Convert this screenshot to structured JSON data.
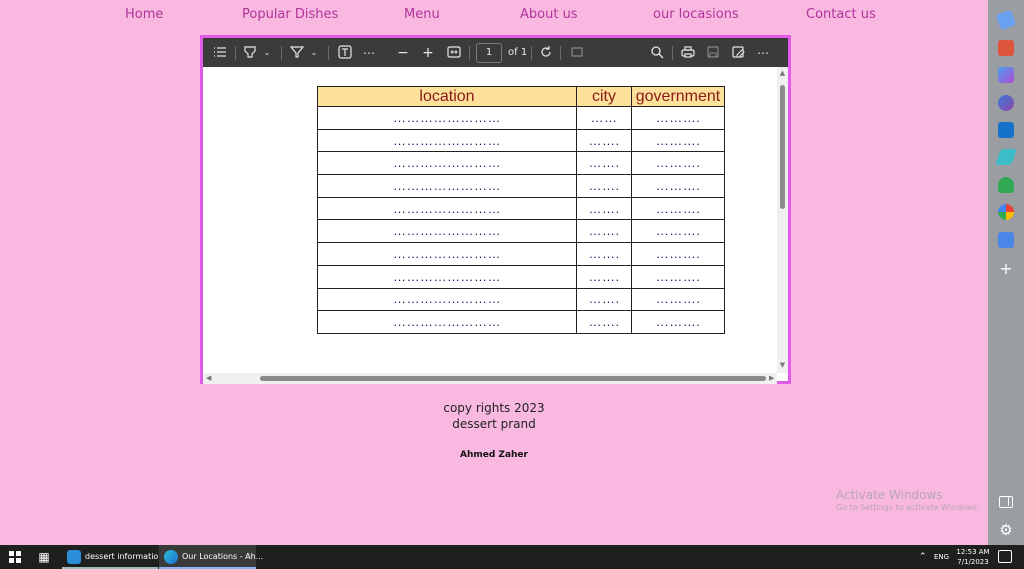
{
  "nav": {
    "items": [
      {
        "label": "Home"
      },
      {
        "label": "Popular Dishes"
      },
      {
        "label": "Menu"
      },
      {
        "label": "About us"
      },
      {
        "label": "our locasions"
      },
      {
        "label": "Contact us"
      }
    ]
  },
  "pdf_viewer": {
    "page_current": "1",
    "page_total_label": "of 1",
    "toolbar_icons": [
      "contents-icon",
      "highlight-icon",
      "draw-icon",
      "text-icon",
      "more-tools-icon",
      "zoom-out-icon",
      "zoom-in-icon",
      "fit-page-icon",
      "rotate-icon",
      "page-view-icon",
      "search-icon",
      "print-icon",
      "save-icon",
      "save-as-icon",
      "more-icon"
    ],
    "table": {
      "headers": [
        "location",
        "city",
        "government"
      ],
      "rows": [
        [
          "……………………",
          "……",
          "………."
        ],
        [
          "……………………",
          "…….",
          "………."
        ],
        [
          "……………………",
          "…….",
          "………."
        ],
        [
          "……………………",
          "…….",
          "………."
        ],
        [
          "……………………",
          "…….",
          "………."
        ],
        [
          "……………………",
          "…….",
          "………."
        ],
        [
          "……………………",
          "…….",
          "………."
        ],
        [
          "……………………",
          "…….",
          "………."
        ],
        [
          "……………………",
          "…….",
          "………."
        ],
        [
          "……………………",
          "…….",
          "………."
        ]
      ],
      "header_bg": "#fde19a",
      "header_text_color": "#8a1a1a"
    }
  },
  "footer": {
    "copyright": "copy rights 2023",
    "brand": "dessert prand",
    "author": "Ahmed Zaher"
  },
  "watermark": {
    "title": "Activate Windows",
    "subtitle": "Go to Settings to activate Windows."
  },
  "taskbar": {
    "apps": [
      {
        "label": "dessert information...",
        "icon": "vscode-icon"
      },
      {
        "label": "Our Locations - Ah...",
        "icon": "edge-icon"
      }
    ],
    "tray": {
      "language": "ENG",
      "time": "12:53 AM",
      "date": "7/1/2023"
    }
  },
  "colors": {
    "page_bg": "#f8b8e0",
    "nav_text": "#b0349a",
    "frame_border": "#e05be6",
    "toolbar_bg": "#3b3b3b"
  }
}
